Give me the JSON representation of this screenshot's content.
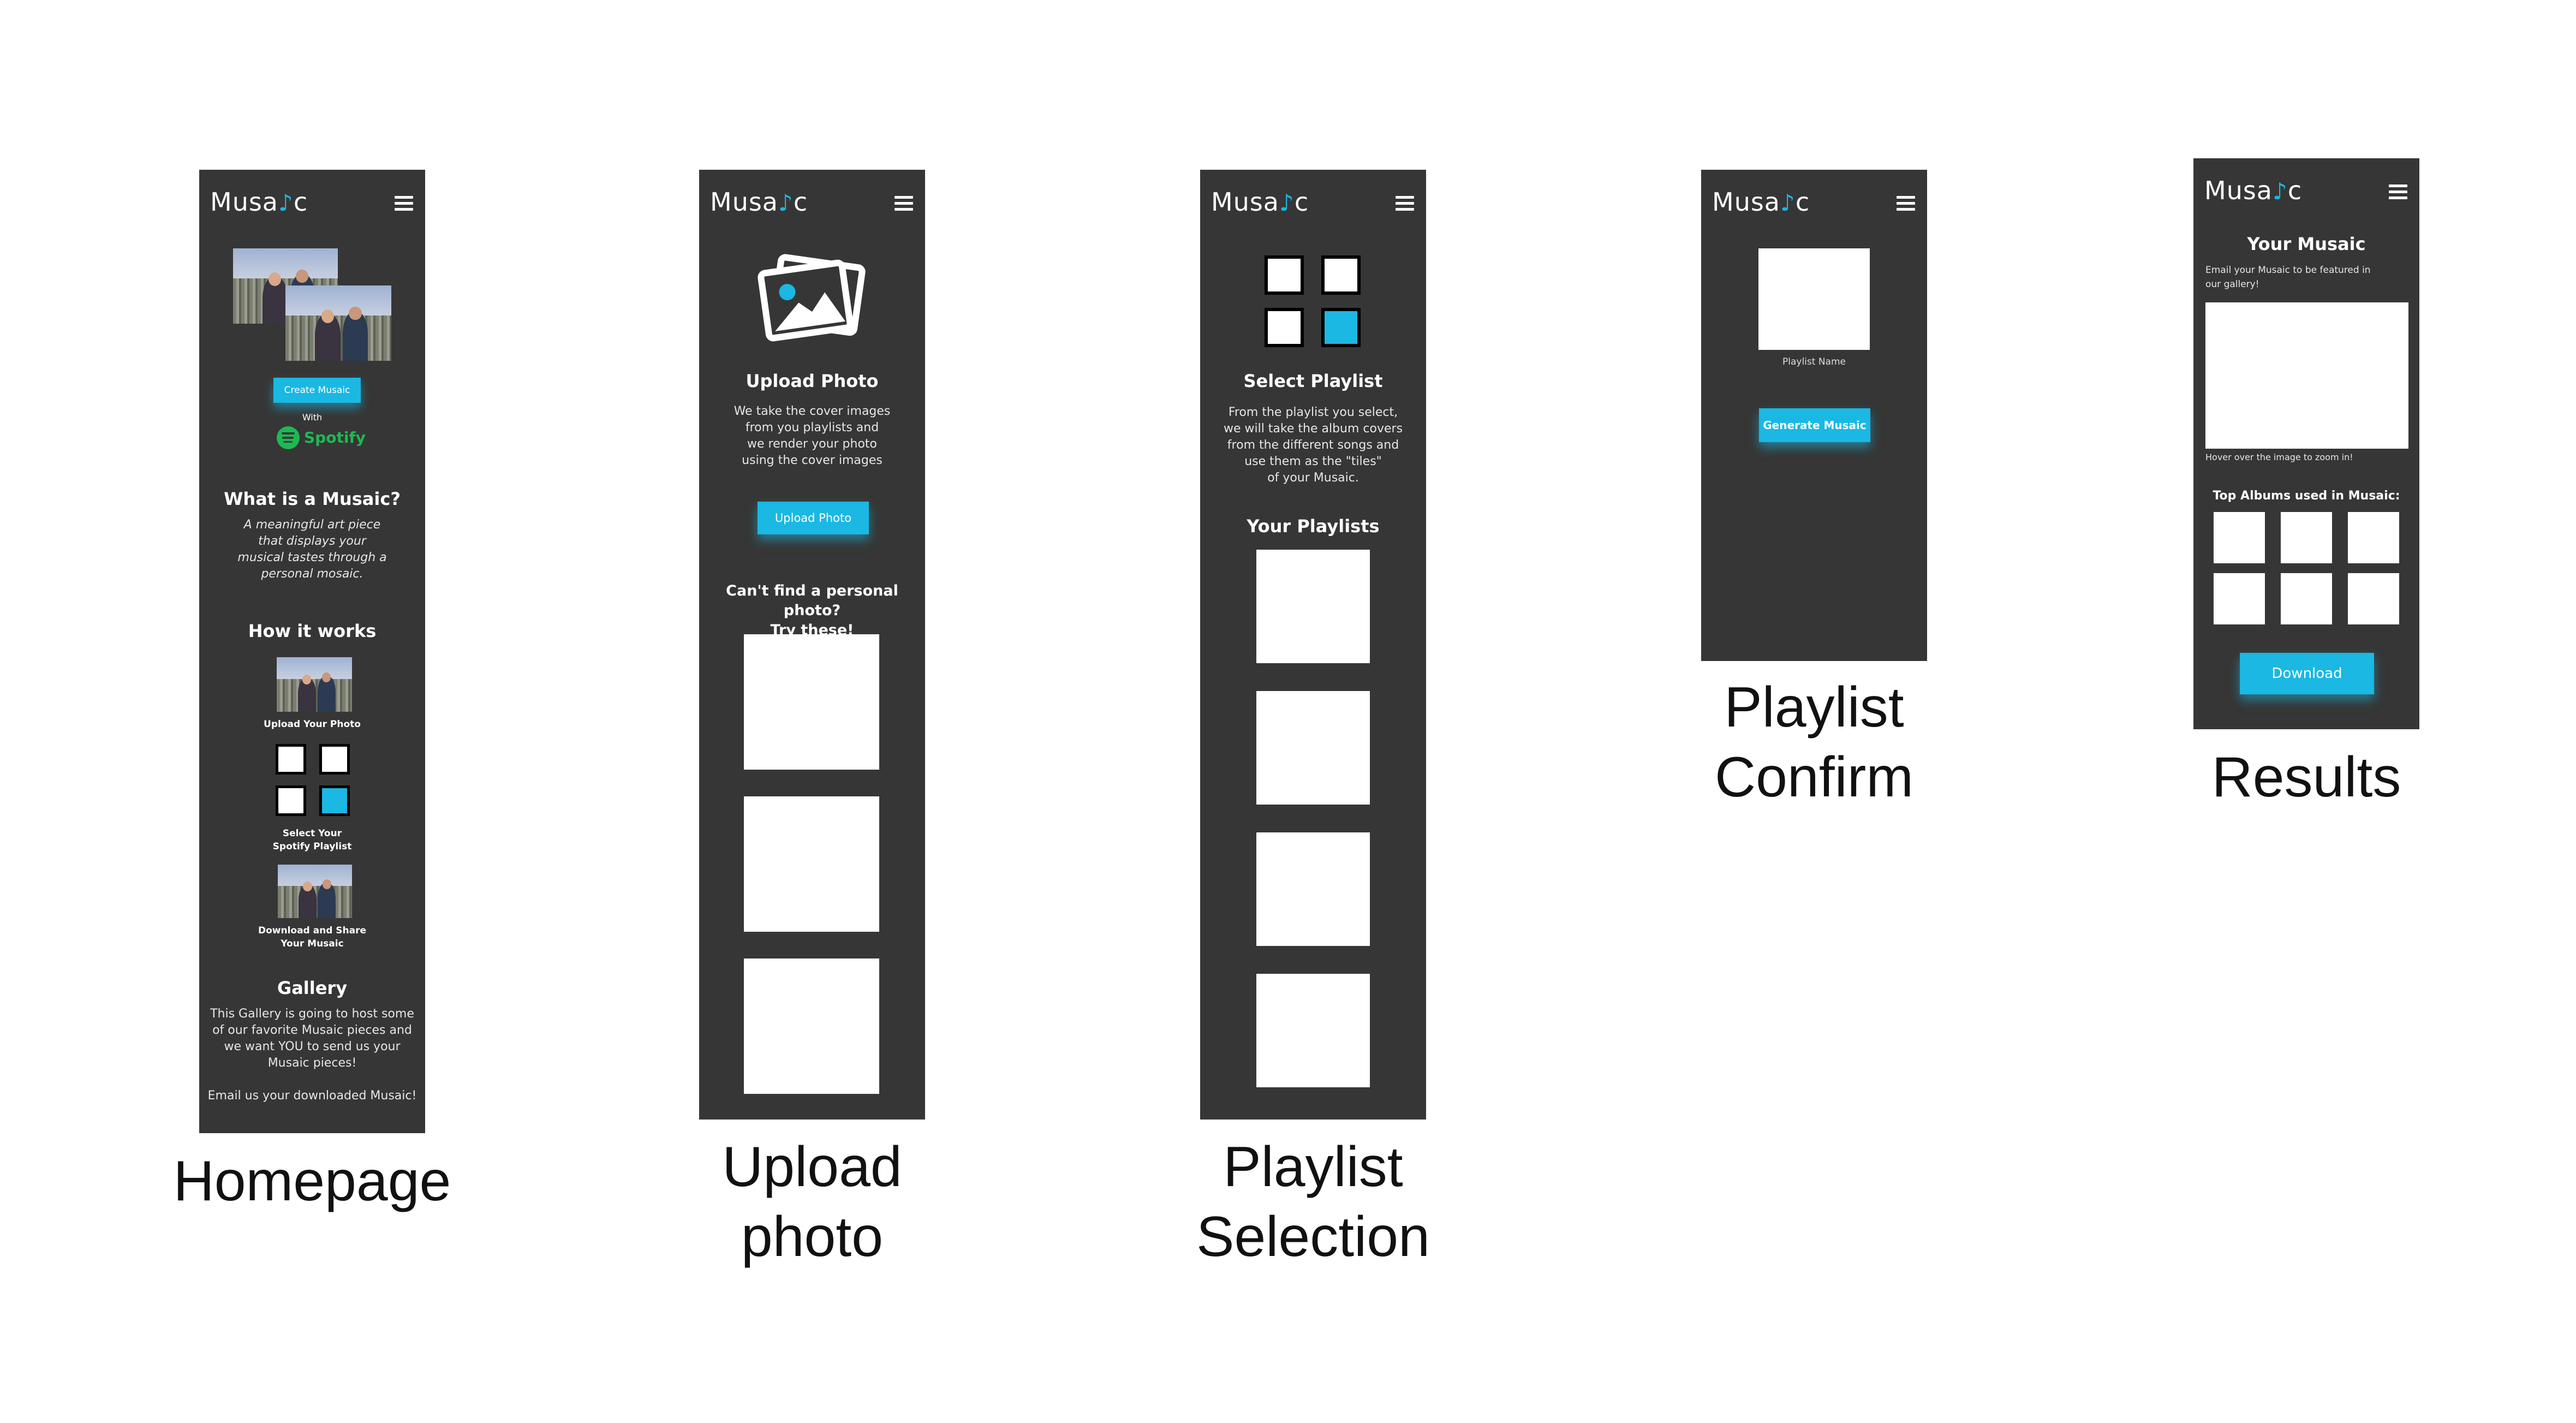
{
  "brand": {
    "logo_prefix": "Musa",
    "logo_note": "♪",
    "logo_suffix": "c",
    "accent": "#1ab8e3",
    "screen_bg": "#363636"
  },
  "screens": {
    "homepage": {
      "caption": "Homepage",
      "create_button": "Create Musaic",
      "with_label": "With",
      "spotify_label": "Spotify",
      "what_title": "What is a Musaic?",
      "what_body": [
        "A meaningful art piece",
        "that displays your",
        "musical tastes through a",
        "personal mosaic."
      ],
      "how_title": "How it works",
      "step1": "Upload Your Photo",
      "step2": [
        "Select Your",
        "Spotify Playlist"
      ],
      "step3": [
        "Download and Share",
        "Your Musaic"
      ],
      "gallery_title": "Gallery",
      "gallery_body": [
        "This Gallery is going to host some",
        "of our favorite Musaic pieces and",
        "we want YOU to send us your",
        "Musaic pieces!"
      ],
      "email_line": "Email us your downloaded Musaic!"
    },
    "upload": {
      "caption": [
        "Upload",
        "photo"
      ],
      "title": "Upload Photo",
      "body": [
        "We take the cover images",
        "from you playlists and",
        "we render your photo",
        "using the cover images"
      ],
      "button": "Upload Photo",
      "alt_title": [
        "Can't find a personal photo?",
        "Try these!"
      ]
    },
    "playlist_selection": {
      "caption": [
        "Playlist",
        "Selection"
      ],
      "title": "Select Playlist",
      "body": [
        "From the playlist you select,",
        "we will take the album covers",
        "from the different songs and",
        "use them as the \"tiles\"",
        "of your Musaic."
      ],
      "your_playlists": "Your Playlists"
    },
    "playlist_confirm": {
      "caption": [
        "Playlist",
        "Confirm"
      ],
      "playlist_name": "Playlist Name",
      "button": "Generate Musaic"
    },
    "results": {
      "caption": "Results",
      "title": "Your Musaic",
      "email_text": [
        "Email your Musaic to be featured in",
        "our gallery!"
      ],
      "hover_text": "Hover over the image to zoom in!",
      "top_albums": "Top Albums used in Musaic:",
      "button": "Download"
    }
  }
}
